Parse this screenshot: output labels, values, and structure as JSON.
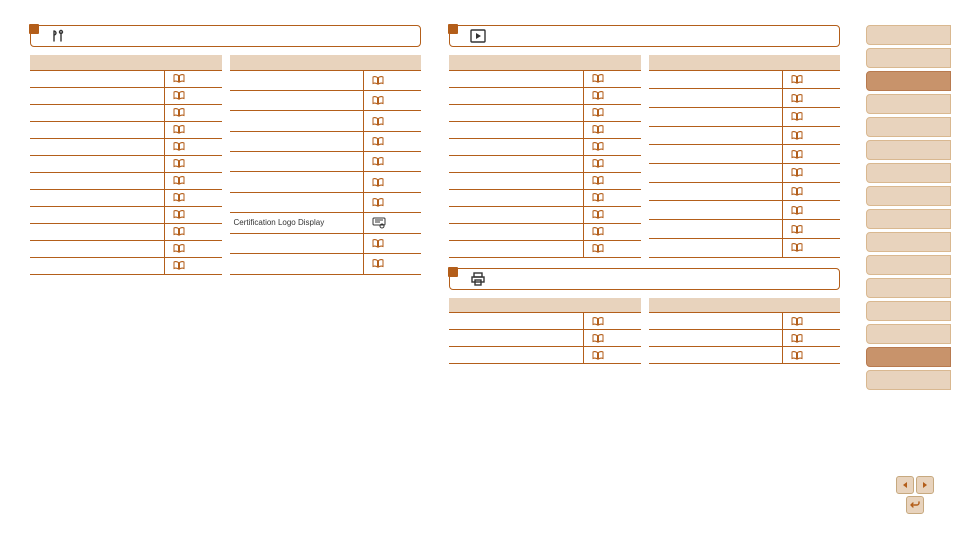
{
  "sections": {
    "setup": {
      "title": "",
      "left": {
        "head_item": "",
        "head_page": "",
        "rows": [
          {
            "label": "",
            "page": ""
          },
          {
            "label": "",
            "page": ""
          },
          {
            "label": "",
            "page": ""
          },
          {
            "label": "",
            "page": ""
          },
          {
            "label": "",
            "page": ""
          },
          {
            "label": "",
            "page": ""
          },
          {
            "label": "",
            "page": ""
          },
          {
            "label": "",
            "page": ""
          },
          {
            "label": "",
            "page": ""
          },
          {
            "label": "",
            "page": ""
          },
          {
            "label": "",
            "page": ""
          },
          {
            "label": "",
            "page": ""
          }
        ]
      },
      "right": {
        "head_item": "",
        "head_page": "",
        "rows": [
          {
            "label": "",
            "page": ""
          },
          {
            "label": "",
            "page": ""
          },
          {
            "label": "",
            "page": ""
          },
          {
            "label": "",
            "page": ""
          },
          {
            "label": "",
            "page": ""
          },
          {
            "label": "",
            "page": ""
          },
          {
            "label": "",
            "page": ""
          },
          {
            "label": "Certification Logo Display",
            "page": ""
          },
          {
            "label": "",
            "page": ""
          },
          {
            "label": "",
            "page": ""
          }
        ]
      }
    },
    "playback": {
      "title": "",
      "left": {
        "head_item": "",
        "head_page": "",
        "rows": [
          {
            "label": "",
            "page": ""
          },
          {
            "label": "",
            "page": ""
          },
          {
            "label": "",
            "page": ""
          },
          {
            "label": "",
            "page": ""
          },
          {
            "label": "",
            "page": ""
          },
          {
            "label": "",
            "page": ""
          },
          {
            "label": "",
            "page": ""
          },
          {
            "label": "",
            "page": ""
          },
          {
            "label": "",
            "page": ""
          },
          {
            "label": "",
            "page": ""
          },
          {
            "label": "",
            "page": ""
          }
        ]
      },
      "right": {
        "head_item": "",
        "head_page": "",
        "rows": [
          {
            "label": "",
            "page": ""
          },
          {
            "label": "",
            "page": ""
          },
          {
            "label": "",
            "page": ""
          },
          {
            "label": "",
            "page": ""
          },
          {
            "label": "",
            "page": ""
          },
          {
            "label": "",
            "page": ""
          },
          {
            "label": "",
            "page": ""
          },
          {
            "label": "",
            "page": ""
          },
          {
            "label": "",
            "page": ""
          },
          {
            "label": "",
            "page": ""
          }
        ]
      }
    },
    "print": {
      "title": "",
      "left": {
        "head_item": "",
        "head_page": "",
        "rows": [
          {
            "label": "",
            "page": ""
          },
          {
            "label": "",
            "page": ""
          },
          {
            "label": "",
            "page": ""
          }
        ]
      },
      "right": {
        "head_item": "",
        "head_page": "",
        "rows": [
          {
            "label": "",
            "page": ""
          },
          {
            "label": "",
            "page": ""
          },
          {
            "label": "",
            "page": ""
          }
        ]
      }
    }
  },
  "sidebar": {
    "tabs": [
      "",
      "",
      "",
      "",
      "",
      "",
      "",
      "",
      "",
      "",
      "",
      "",
      "",
      "",
      "",
      ""
    ],
    "activeIndex": 2,
    "active2": 14
  }
}
